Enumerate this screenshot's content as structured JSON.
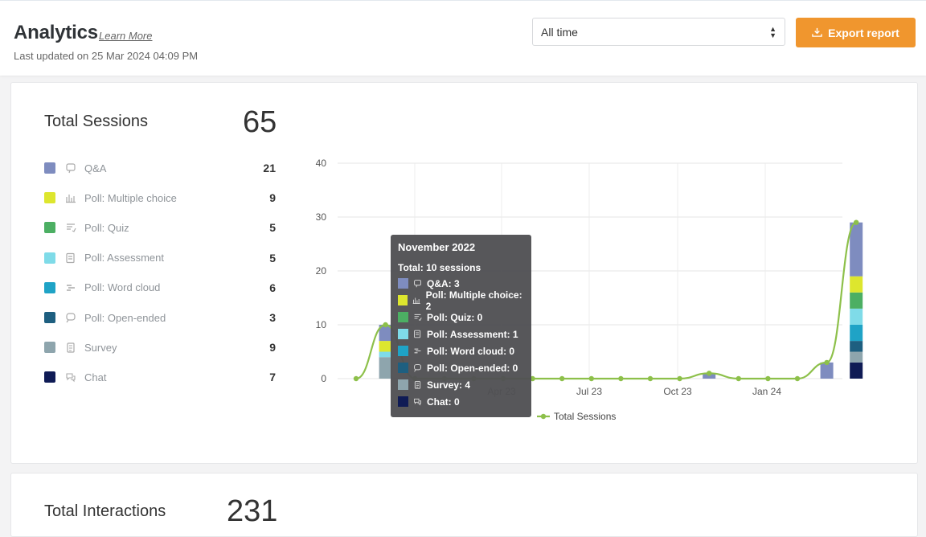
{
  "header": {
    "title": "Analytics",
    "learn_more": "Learn More",
    "last_updated": "Last updated on 25 Mar 2024 04:09 PM",
    "range_select": "All time",
    "export_label": "Export report"
  },
  "colors": {
    "accent": "#f0962e",
    "line": "#8dc04a",
    "tooltip_bg": "#505053"
  },
  "sessions": {
    "title": "Total Sessions",
    "total": "65",
    "items": [
      {
        "label": "Q&A",
        "value": "21",
        "color": "#7e8cbf",
        "icon": "qa-icon"
      },
      {
        "label": "Poll: Multiple choice",
        "value": "9",
        "color": "#dde62e",
        "icon": "bar-chart-icon"
      },
      {
        "label": "Poll: Quiz",
        "value": "5",
        "color": "#4caf63",
        "icon": "quiz-icon"
      },
      {
        "label": "Poll: Assessment",
        "value": "5",
        "color": "#7fdbe8",
        "icon": "assessment-icon"
      },
      {
        "label": "Poll: Word cloud",
        "value": "6",
        "color": "#1fa3c6",
        "icon": "word-cloud-icon"
      },
      {
        "label": "Poll: Open-ended",
        "value": "3",
        "color": "#1e5f80",
        "icon": "open-ended-icon"
      },
      {
        "label": "Survey",
        "value": "9",
        "color": "#8ea5ad",
        "icon": "survey-icon"
      },
      {
        "label": "Chat",
        "value": "7",
        "color": "#0f1b55",
        "icon": "chat-icon"
      }
    ]
  },
  "interactions": {
    "title": "Total Interactions",
    "total": "231"
  },
  "chart_data": {
    "type": "bar",
    "stacked": true,
    "overlay_line": "Total Sessions",
    "ylim": [
      0,
      40
    ],
    "yticks": [
      "0",
      "10",
      "20",
      "30",
      "40"
    ],
    "xticks": [
      "Apr 23",
      "Jul 23",
      "Oct 23",
      "Jan 24"
    ],
    "legend": [
      "Total Sessions"
    ],
    "legend_position": "bottom",
    "line_values": [
      0,
      10,
      0,
      0,
      0,
      0,
      0,
      0,
      0,
      0,
      0,
      0,
      1,
      0,
      0,
      0,
      3,
      29
    ],
    "bars": [
      {
        "index": 1,
        "segments": {
          "Q&A": 3,
          "Poll: Multiple choice": 2,
          "Poll: Assessment": 1,
          "Survey": 4
        }
      },
      {
        "index": 16,
        "segments": {
          "Q&A": 3
        }
      },
      {
        "index": 17,
        "segments": {
          "Chat": 3,
          "Survey": 2,
          "Poll: Open-ended": 2,
          "Poll: Word cloud": 3,
          "Poll: Assessment": 3,
          "Poll: Quiz": 3,
          "Poll: Multiple choice": 3,
          "Q&A": 10
        }
      },
      {
        "index": 12,
        "segments": {
          "Q&A": 1
        }
      }
    ]
  },
  "tooltip": {
    "title": "November 2022",
    "total": "Total: 10 sessions",
    "rows": [
      {
        "label": "Q&A: 3",
        "color": "#7e8cbf",
        "icon": "qa-icon"
      },
      {
        "label": "Poll: Multiple choice: 2",
        "color": "#dde62e",
        "icon": "bar-chart-icon"
      },
      {
        "label": "Poll: Quiz: 0",
        "color": "#4caf63",
        "icon": "quiz-icon"
      },
      {
        "label": "Poll: Assessment: 1",
        "color": "#7fdbe8",
        "icon": "assessment-icon"
      },
      {
        "label": "Poll: Word cloud: 0",
        "color": "#1fa3c6",
        "icon": "word-cloud-icon"
      },
      {
        "label": "Poll: Open-ended: 0",
        "color": "#1e5f80",
        "icon": "open-ended-icon"
      },
      {
        "label": "Survey: 4",
        "color": "#8ea5ad",
        "icon": "survey-icon"
      },
      {
        "label": "Chat: 0",
        "color": "#0f1b55",
        "icon": "chat-icon"
      }
    ]
  }
}
